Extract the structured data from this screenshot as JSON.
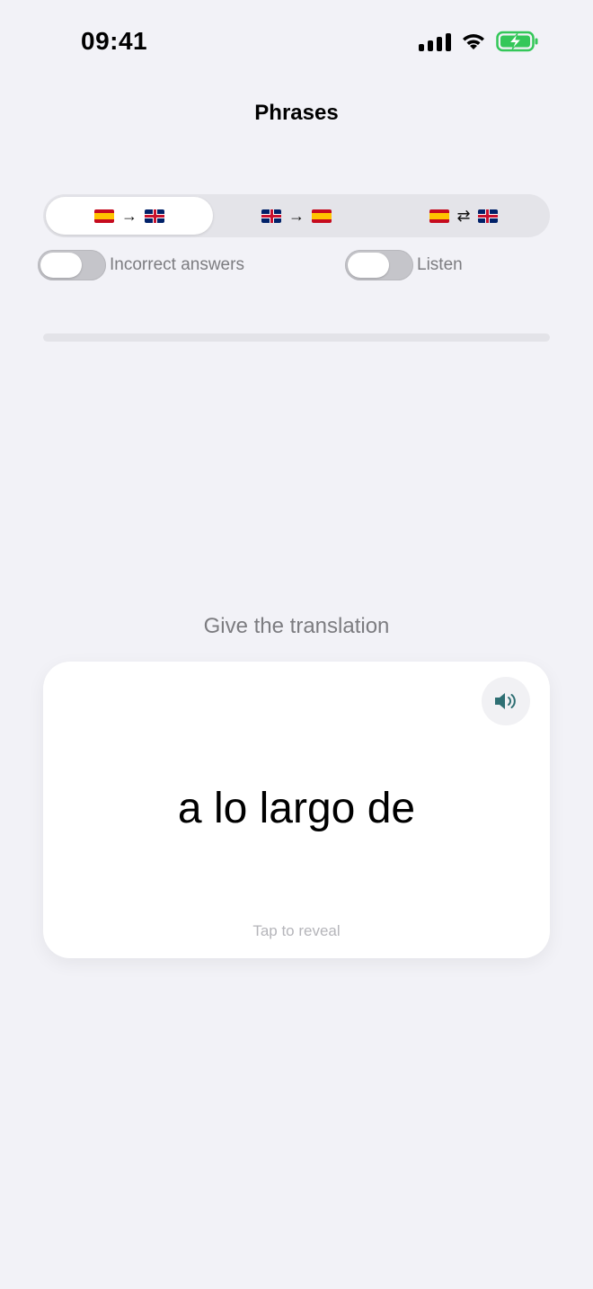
{
  "status_bar": {
    "time": "09:41",
    "icons": [
      "cellular-signal-icon",
      "wifi-icon",
      "battery-charging-icon"
    ]
  },
  "nav": {
    "title": "Phrases"
  },
  "direction_modes": {
    "options": [
      {
        "from": "spain-flag",
        "arrow": "→",
        "to": "uk-flag",
        "selected": true
      },
      {
        "from": "uk-flag",
        "arrow": "→",
        "to": "spain-flag",
        "selected": false
      },
      {
        "from": "spain-flag",
        "arrow": "⇄",
        "to": "uk-flag",
        "selected": false
      }
    ]
  },
  "toggles": {
    "incorrect_answers": {
      "label": "Incorrect answers",
      "on": false
    },
    "listen": {
      "label": "Listen",
      "on": false
    }
  },
  "progress": {
    "fraction": 0.0
  },
  "quiz": {
    "prompt": "Give the translation",
    "phrase": "a lo largo de",
    "hint": "Tap to reveal",
    "audio_icon": "speaker-icon"
  },
  "colors": {
    "accent": "#2e6f73",
    "background": "#f2f2f7",
    "battery": "#34c759"
  }
}
